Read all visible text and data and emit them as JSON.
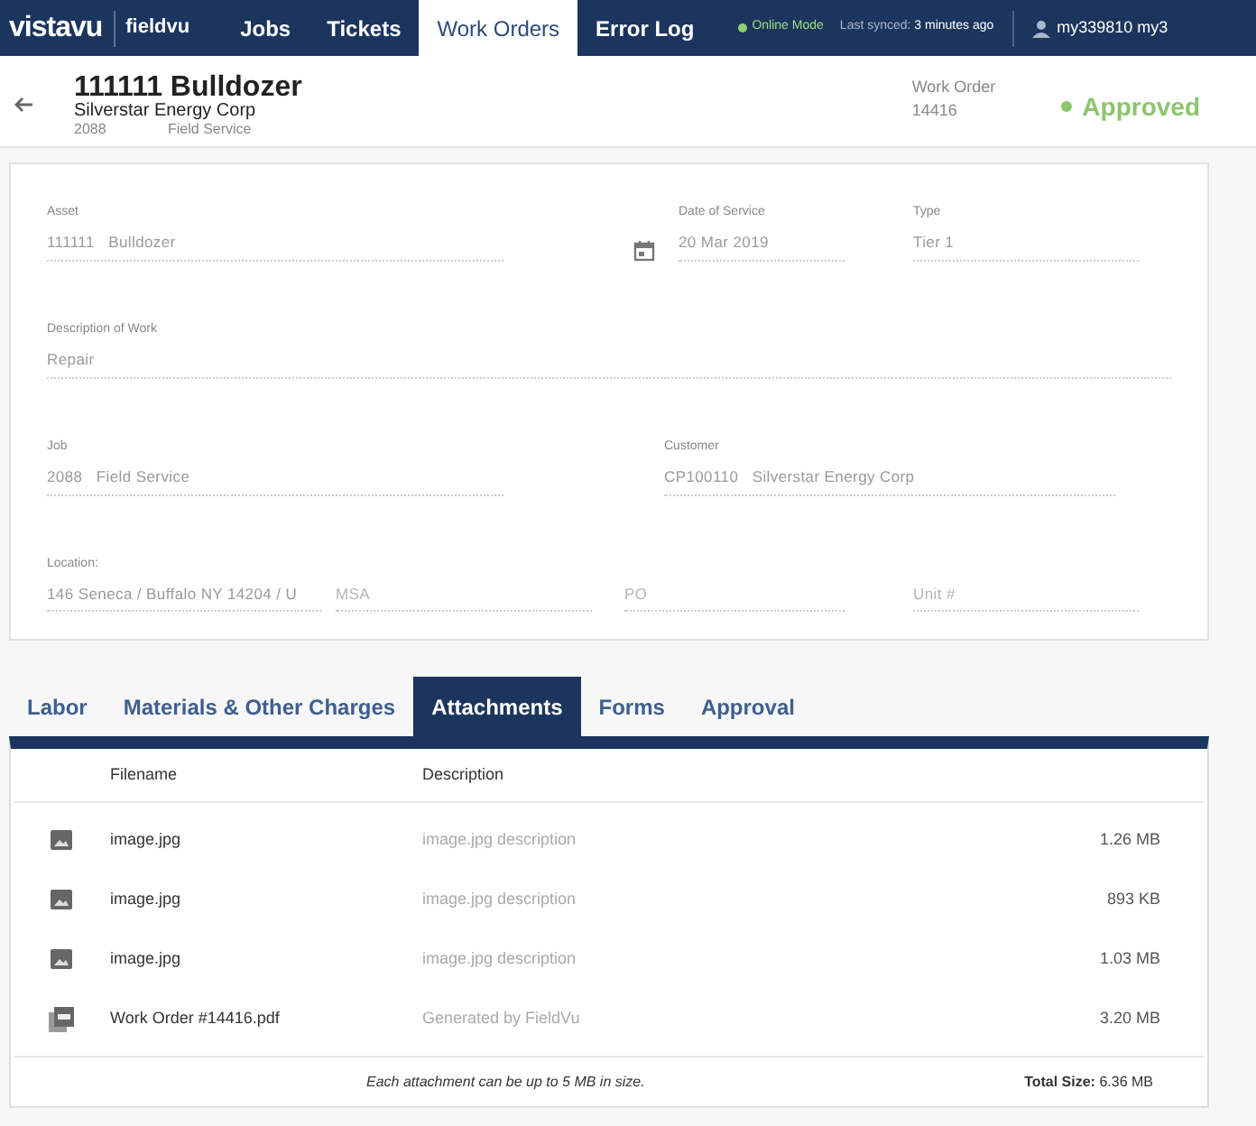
{
  "nav": {
    "logo": {
      "brand": "vistavu",
      "product": "fieldvu"
    },
    "items": [
      {
        "label": "Jobs",
        "selected": false
      },
      {
        "label": "Tickets",
        "selected": false
      },
      {
        "label": "Work Orders",
        "selected": true
      },
      {
        "label": "Error Log",
        "selected": false
      }
    ],
    "connection": {
      "label": "Online Mode",
      "online": true
    },
    "last_synced": "Last synced: **3 minutes ago**",
    "user": "my339810 my3"
  },
  "header": {
    "title": "111111 Bulldozer",
    "customer": "Silverstar Energy Corp",
    "job_number": "2088",
    "job_name": "Field Service",
    "work_order_label": "Work Order",
    "work_order_number": "14416",
    "status": "Approved"
  },
  "form": {
    "fields": [
      {
        "label": "Asset",
        "value": "111111   Bulldozer"
      },
      {
        "label": "Date of Service",
        "value": "20 Mar 2019"
      },
      {
        "label": "Type",
        "value": "Tier 1"
      },
      {
        "label": "Description of Work",
        "value": "Repair"
      },
      {
        "label": "Job",
        "value": "2088   Field Service"
      },
      {
        "label": "Customer",
        "value": "CP100110   Silverstar Energy Corp"
      },
      {
        "label": "Location:",
        "value": "146 Seneca / Buffalo NY 14204 / U"
      },
      {
        "placeholder": "MSA"
      },
      {
        "placeholder": "PO"
      },
      {
        "placeholder": "Unit #"
      }
    ]
  },
  "tabs": [
    {
      "label": "Labor",
      "selected": false
    },
    {
      "label": "Materials & Other Charges",
      "selected": false
    },
    {
      "label": "Attachments",
      "selected": true
    },
    {
      "label": "Forms",
      "selected": false
    },
    {
      "label": "Approval",
      "selected": false
    }
  ],
  "attachments": {
    "columns": [
      "Filename",
      "Description"
    ],
    "rows": [
      {
        "kind": "image",
        "filename": "image.jpg",
        "description": "image.jpg description",
        "size": "1.26 MB"
      },
      {
        "kind": "image",
        "filename": "image.jpg",
        "description": "image.jpg description",
        "size": "893 KB"
      },
      {
        "kind": "image",
        "filename": "image.jpg",
        "description": "image.jpg description",
        "size": "1.03 MB"
      },
      {
        "kind": "pdf",
        "filename": "Work Order #14416.pdf",
        "description": "Generated by FieldVu",
        "size": "3.20 MB"
      }
    ],
    "note": "Each attachment can be up to 5 MB in size.",
    "total": "**Total Size:** 6.36 MB"
  }
}
